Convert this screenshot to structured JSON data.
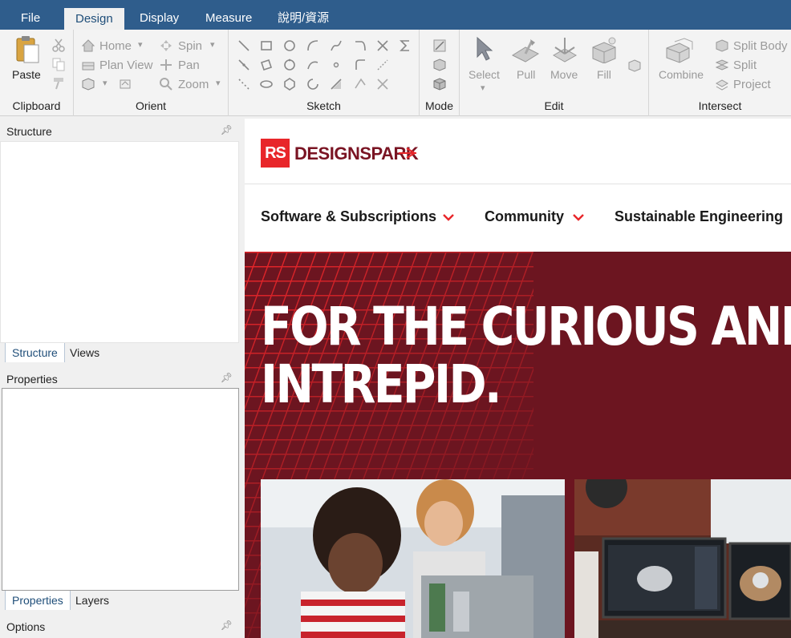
{
  "menu": {
    "tabs": [
      "File",
      "Design",
      "Display",
      "Measure",
      "說明/資源"
    ],
    "active": "Design"
  },
  "ribbon": {
    "clipboard": {
      "paste": "Paste",
      "title": "Clipboard"
    },
    "orient": {
      "home": "Home",
      "plan_view": "Plan View",
      "spin": "Spin",
      "pan": "Pan",
      "zoom": "Zoom",
      "title": "Orient"
    },
    "sketch": {
      "title": "Sketch"
    },
    "mode": {
      "title": "Mode"
    },
    "edit": {
      "select": "Select",
      "pull": "Pull",
      "move": "Move",
      "fill": "Fill",
      "title": "Edit"
    },
    "intersect": {
      "combine": "Combine",
      "split_body": "Split Body",
      "split": "Split",
      "project": "Project",
      "title": "Intersect"
    }
  },
  "panels": {
    "structure": {
      "title": "Structure",
      "tabs": [
        "Structure",
        "Views"
      ]
    },
    "properties": {
      "title": "Properties",
      "tabs": [
        "Properties",
        "Layers"
      ]
    },
    "options": {
      "title": "Options"
    }
  },
  "website": {
    "logo_mark": "RS",
    "logo_text": "DESIGNSPARK",
    "nav": [
      "Software & Subscriptions",
      "Community",
      "Sustainable Engineering"
    ],
    "hero_line1": "FOR THE CURIOUS AND",
    "hero_line2": "INTREPID.",
    "colors": {
      "brand_red": "#e8262a",
      "hero_bg": "#6c1520",
      "menubar": "#2f5d8c"
    }
  }
}
